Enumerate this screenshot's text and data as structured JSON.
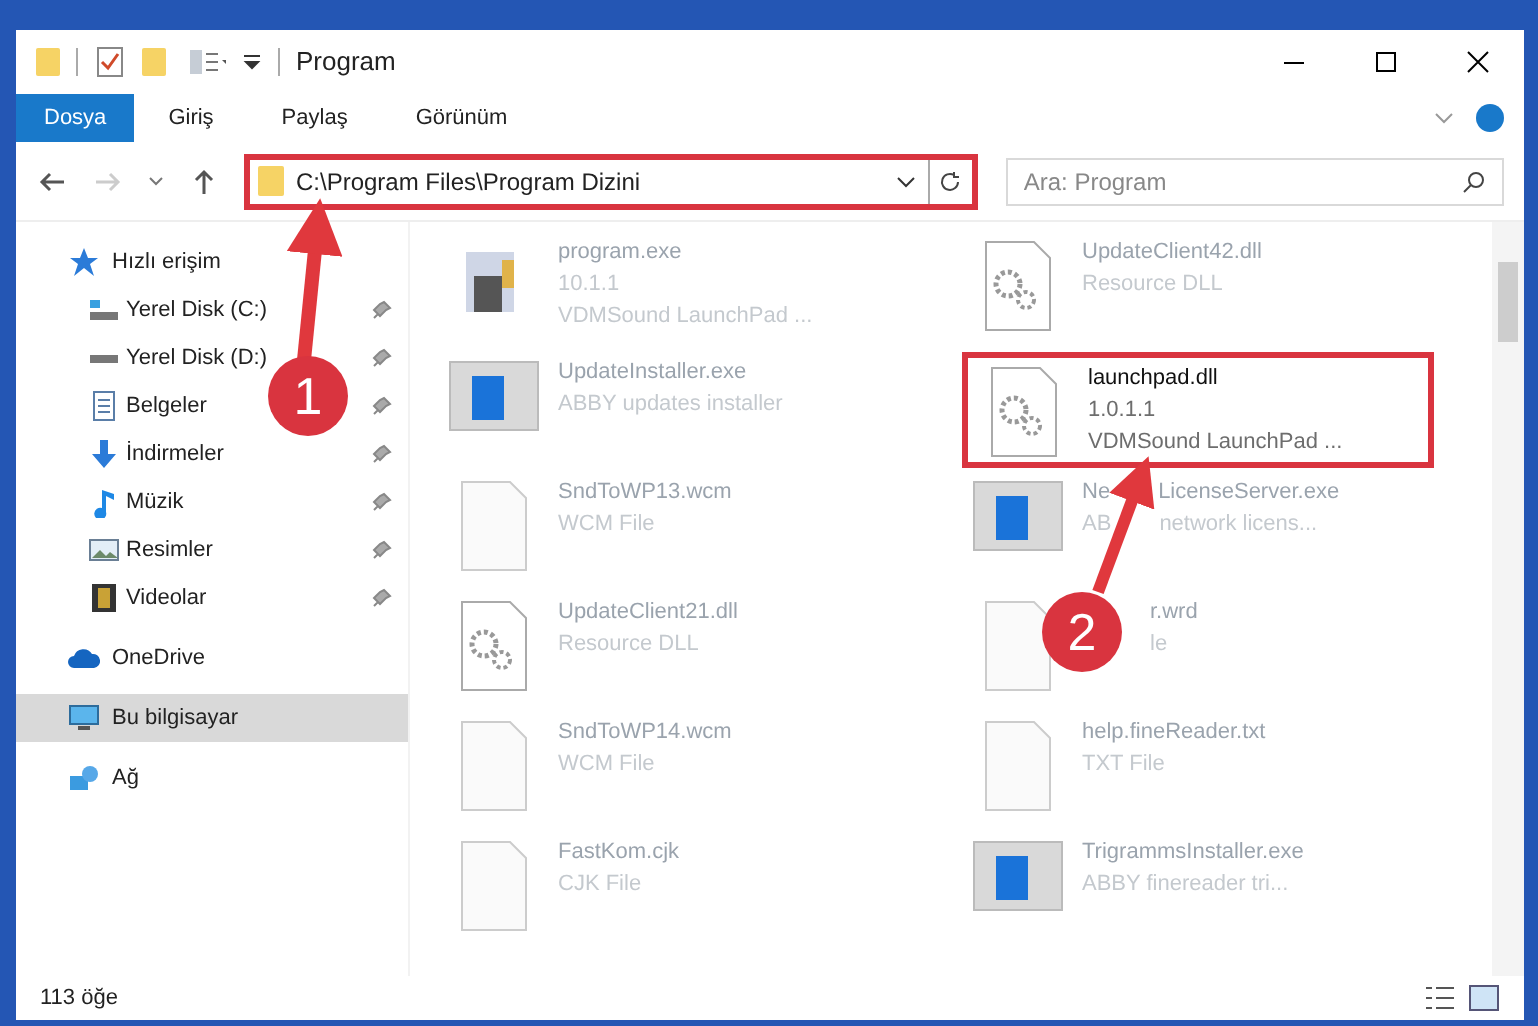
{
  "window": {
    "title": "Program"
  },
  "ribbon_tabs": [
    {
      "label": "Dosya",
      "selected": true
    },
    {
      "label": "Giriş",
      "selected": false
    },
    {
      "label": "Paylaş",
      "selected": false
    },
    {
      "label": "Görünüm",
      "selected": false
    }
  ],
  "address_bar": {
    "path": "C:\\Program Files\\Program Dizini",
    "highlighted": true
  },
  "search": {
    "placeholder": "Ara: Program"
  },
  "nav_pane": {
    "items": [
      {
        "label": "Hızlı erişim",
        "kind": "star",
        "selected": false,
        "children": [
          {
            "label": "Yerel Disk (C:)",
            "kind": "drive-c",
            "selected": false,
            "pinned": true
          },
          {
            "label": "Yerel Disk (D:)",
            "kind": "drive",
            "selected": false,
            "pinned": true
          },
          {
            "label": "Belgeler",
            "kind": "documents",
            "selected": false,
            "pinned": true
          },
          {
            "label": "İndirmeler",
            "kind": "downloads",
            "selected": false,
            "pinned": true
          },
          {
            "label": "Müzik",
            "kind": "music",
            "selected": false,
            "pinned": true
          },
          {
            "label": "Resimler",
            "kind": "pictures",
            "selected": false,
            "pinned": true
          },
          {
            "label": "Videolar",
            "kind": "videos",
            "selected": false,
            "pinned": true
          }
        ]
      },
      {
        "label": "OneDrive",
        "kind": "cloud",
        "selected": false
      },
      {
        "label": "Bu bilgisayar",
        "kind": "pc",
        "selected": true
      },
      {
        "label": "Ağ",
        "kind": "network",
        "selected": false
      }
    ]
  },
  "files": [
    {
      "name": "program.exe",
      "lines": [
        "10.1.1",
        "VDMSound LaunchPad ..."
      ],
      "kind": "program",
      "highlighted": false,
      "covered": false
    },
    {
      "name": "UpdateClient42.dll",
      "lines": [
        "Resource DLL"
      ],
      "kind": "dll",
      "highlighted": false,
      "covered": false
    },
    {
      "name": "UpdateInstaller.exe",
      "lines": [
        "ABBY updates installer"
      ],
      "kind": "app",
      "highlighted": false,
      "covered": false
    },
    {
      "name": "launchpad.dll",
      "lines": [
        "1.0.1.1",
        "VDMSound LaunchPad ..."
      ],
      "kind": "dll",
      "highlighted": true,
      "covered": false
    },
    {
      "name": "SndToWP13.wcm",
      "lines": [
        "WCM File"
      ],
      "kind": "doc",
      "highlighted": false,
      "covered": false
    },
    {
      "name": [
        "Ne",
        "LicenseServer.exe"
      ],
      "lines": [
        [
          "AB",
          "network licens..."
        ]
      ],
      "kind": "app",
      "highlighted": false,
      "covered": false
    },
    {
      "name": "UpdateClient21.dll",
      "lines": [
        "Resource DLL"
      ],
      "kind": "dll",
      "highlighted": false,
      "covered": false
    },
    {
      "name": "r.wrd",
      "lines": [
        "le"
      ],
      "kind": "doc",
      "highlighted": false,
      "covered": true
    },
    {
      "name": "SndToWP14.wcm",
      "lines": [
        "WCM File"
      ],
      "kind": "doc",
      "highlighted": false,
      "covered": false
    },
    {
      "name": "help.fineReader.txt",
      "lines": [
        "TXT File"
      ],
      "kind": "doc",
      "highlighted": false,
      "covered": false
    },
    {
      "name": "FastKom.cjk",
      "lines": [
        "CJK File"
      ],
      "kind": "doc",
      "highlighted": false,
      "covered": false
    },
    {
      "name": "TrigrammsInstaller.exe",
      "lines": [
        "ABBY finereader tri..."
      ],
      "kind": "app",
      "highlighted": false,
      "covered": false
    }
  ],
  "status_bar": {
    "count": "113 öğe"
  },
  "annotations": [
    {
      "number": "1"
    },
    {
      "number": "2"
    }
  ]
}
